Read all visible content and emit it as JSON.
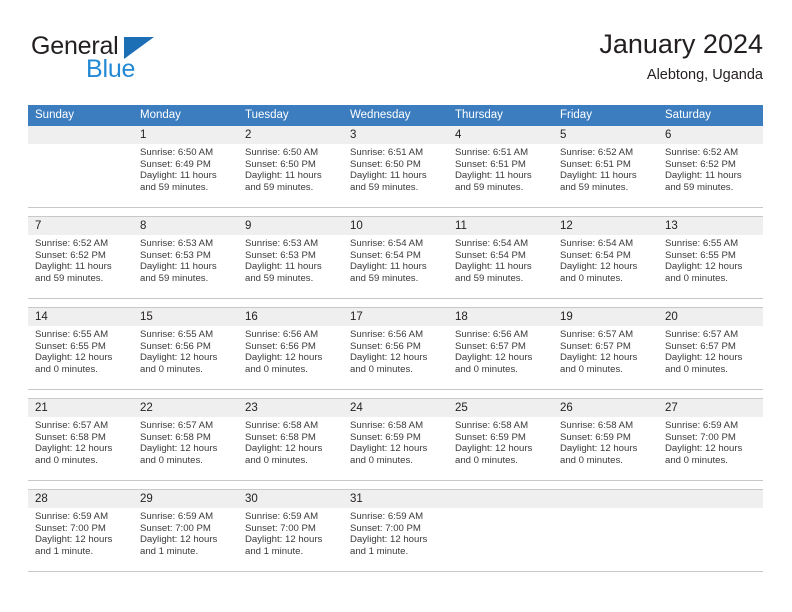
{
  "brand": {
    "word_general": "General",
    "word_blue": "Blue",
    "triangle_color": "#1c6fb5",
    "blue_color": "#2389d4"
  },
  "header": {
    "title": "January 2024",
    "subtitle": "Alebtong, Uganda"
  },
  "calendar": {
    "header_bg": "#3c7dc0",
    "day_band_bg": "#efefef",
    "weekdays": [
      "Sunday",
      "Monday",
      "Tuesday",
      "Wednesday",
      "Thursday",
      "Friday",
      "Saturday"
    ],
    "weeks": [
      [
        {
          "date": "",
          "sunrise": "",
          "sunset": "",
          "daylight_line1": "",
          "daylight_line2": ""
        },
        {
          "date": "1",
          "sunrise": "Sunrise: 6:50 AM",
          "sunset": "Sunset: 6:49 PM",
          "daylight_line1": "Daylight: 11 hours",
          "daylight_line2": "and 59 minutes."
        },
        {
          "date": "2",
          "sunrise": "Sunrise: 6:50 AM",
          "sunset": "Sunset: 6:50 PM",
          "daylight_line1": "Daylight: 11 hours",
          "daylight_line2": "and 59 minutes."
        },
        {
          "date": "3",
          "sunrise": "Sunrise: 6:51 AM",
          "sunset": "Sunset: 6:50 PM",
          "daylight_line1": "Daylight: 11 hours",
          "daylight_line2": "and 59 minutes."
        },
        {
          "date": "4",
          "sunrise": "Sunrise: 6:51 AM",
          "sunset": "Sunset: 6:51 PM",
          "daylight_line1": "Daylight: 11 hours",
          "daylight_line2": "and 59 minutes."
        },
        {
          "date": "5",
          "sunrise": "Sunrise: 6:52 AM",
          "sunset": "Sunset: 6:51 PM",
          "daylight_line1": "Daylight: 11 hours",
          "daylight_line2": "and 59 minutes."
        },
        {
          "date": "6",
          "sunrise": "Sunrise: 6:52 AM",
          "sunset": "Sunset: 6:52 PM",
          "daylight_line1": "Daylight: 11 hours",
          "daylight_line2": "and 59 minutes."
        }
      ],
      [
        {
          "date": "7",
          "sunrise": "Sunrise: 6:52 AM",
          "sunset": "Sunset: 6:52 PM",
          "daylight_line1": "Daylight: 11 hours",
          "daylight_line2": "and 59 minutes."
        },
        {
          "date": "8",
          "sunrise": "Sunrise: 6:53 AM",
          "sunset": "Sunset: 6:53 PM",
          "daylight_line1": "Daylight: 11 hours",
          "daylight_line2": "and 59 minutes."
        },
        {
          "date": "9",
          "sunrise": "Sunrise: 6:53 AM",
          "sunset": "Sunset: 6:53 PM",
          "daylight_line1": "Daylight: 11 hours",
          "daylight_line2": "and 59 minutes."
        },
        {
          "date": "10",
          "sunrise": "Sunrise: 6:54 AM",
          "sunset": "Sunset: 6:54 PM",
          "daylight_line1": "Daylight: 11 hours",
          "daylight_line2": "and 59 minutes."
        },
        {
          "date": "11",
          "sunrise": "Sunrise: 6:54 AM",
          "sunset": "Sunset: 6:54 PM",
          "daylight_line1": "Daylight: 11 hours",
          "daylight_line2": "and 59 minutes."
        },
        {
          "date": "12",
          "sunrise": "Sunrise: 6:54 AM",
          "sunset": "Sunset: 6:54 PM",
          "daylight_line1": "Daylight: 12 hours",
          "daylight_line2": "and 0 minutes."
        },
        {
          "date": "13",
          "sunrise": "Sunrise: 6:55 AM",
          "sunset": "Sunset: 6:55 PM",
          "daylight_line1": "Daylight: 12 hours",
          "daylight_line2": "and 0 minutes."
        }
      ],
      [
        {
          "date": "14",
          "sunrise": "Sunrise: 6:55 AM",
          "sunset": "Sunset: 6:55 PM",
          "daylight_line1": "Daylight: 12 hours",
          "daylight_line2": "and 0 minutes."
        },
        {
          "date": "15",
          "sunrise": "Sunrise: 6:55 AM",
          "sunset": "Sunset: 6:56 PM",
          "daylight_line1": "Daylight: 12 hours",
          "daylight_line2": "and 0 minutes."
        },
        {
          "date": "16",
          "sunrise": "Sunrise: 6:56 AM",
          "sunset": "Sunset: 6:56 PM",
          "daylight_line1": "Daylight: 12 hours",
          "daylight_line2": "and 0 minutes."
        },
        {
          "date": "17",
          "sunrise": "Sunrise: 6:56 AM",
          "sunset": "Sunset: 6:56 PM",
          "daylight_line1": "Daylight: 12 hours",
          "daylight_line2": "and 0 minutes."
        },
        {
          "date": "18",
          "sunrise": "Sunrise: 6:56 AM",
          "sunset": "Sunset: 6:57 PM",
          "daylight_line1": "Daylight: 12 hours",
          "daylight_line2": "and 0 minutes."
        },
        {
          "date": "19",
          "sunrise": "Sunrise: 6:57 AM",
          "sunset": "Sunset: 6:57 PM",
          "daylight_line1": "Daylight: 12 hours",
          "daylight_line2": "and 0 minutes."
        },
        {
          "date": "20",
          "sunrise": "Sunrise: 6:57 AM",
          "sunset": "Sunset: 6:57 PM",
          "daylight_line1": "Daylight: 12 hours",
          "daylight_line2": "and 0 minutes."
        }
      ],
      [
        {
          "date": "21",
          "sunrise": "Sunrise: 6:57 AM",
          "sunset": "Sunset: 6:58 PM",
          "daylight_line1": "Daylight: 12 hours",
          "daylight_line2": "and 0 minutes."
        },
        {
          "date": "22",
          "sunrise": "Sunrise: 6:57 AM",
          "sunset": "Sunset: 6:58 PM",
          "daylight_line1": "Daylight: 12 hours",
          "daylight_line2": "and 0 minutes."
        },
        {
          "date": "23",
          "sunrise": "Sunrise: 6:58 AM",
          "sunset": "Sunset: 6:58 PM",
          "daylight_line1": "Daylight: 12 hours",
          "daylight_line2": "and 0 minutes."
        },
        {
          "date": "24",
          "sunrise": "Sunrise: 6:58 AM",
          "sunset": "Sunset: 6:59 PM",
          "daylight_line1": "Daylight: 12 hours",
          "daylight_line2": "and 0 minutes."
        },
        {
          "date": "25",
          "sunrise": "Sunrise: 6:58 AM",
          "sunset": "Sunset: 6:59 PM",
          "daylight_line1": "Daylight: 12 hours",
          "daylight_line2": "and 0 minutes."
        },
        {
          "date": "26",
          "sunrise": "Sunrise: 6:58 AM",
          "sunset": "Sunset: 6:59 PM",
          "daylight_line1": "Daylight: 12 hours",
          "daylight_line2": "and 0 minutes."
        },
        {
          "date": "27",
          "sunrise": "Sunrise: 6:59 AM",
          "sunset": "Sunset: 7:00 PM",
          "daylight_line1": "Daylight: 12 hours",
          "daylight_line2": "and 0 minutes."
        }
      ],
      [
        {
          "date": "28",
          "sunrise": "Sunrise: 6:59 AM",
          "sunset": "Sunset: 7:00 PM",
          "daylight_line1": "Daylight: 12 hours",
          "daylight_line2": "and 1 minute."
        },
        {
          "date": "29",
          "sunrise": "Sunrise: 6:59 AM",
          "sunset": "Sunset: 7:00 PM",
          "daylight_line1": "Daylight: 12 hours",
          "daylight_line2": "and 1 minute."
        },
        {
          "date": "30",
          "sunrise": "Sunrise: 6:59 AM",
          "sunset": "Sunset: 7:00 PM",
          "daylight_line1": "Daylight: 12 hours",
          "daylight_line2": "and 1 minute."
        },
        {
          "date": "31",
          "sunrise": "Sunrise: 6:59 AM",
          "sunset": "Sunset: 7:00 PM",
          "daylight_line1": "Daylight: 12 hours",
          "daylight_line2": "and 1 minute."
        },
        {
          "date": "",
          "sunrise": "",
          "sunset": "",
          "daylight_line1": "",
          "daylight_line2": ""
        },
        {
          "date": "",
          "sunrise": "",
          "sunset": "",
          "daylight_line1": "",
          "daylight_line2": ""
        },
        {
          "date": "",
          "sunrise": "",
          "sunset": "",
          "daylight_line1": "",
          "daylight_line2": ""
        }
      ]
    ]
  }
}
